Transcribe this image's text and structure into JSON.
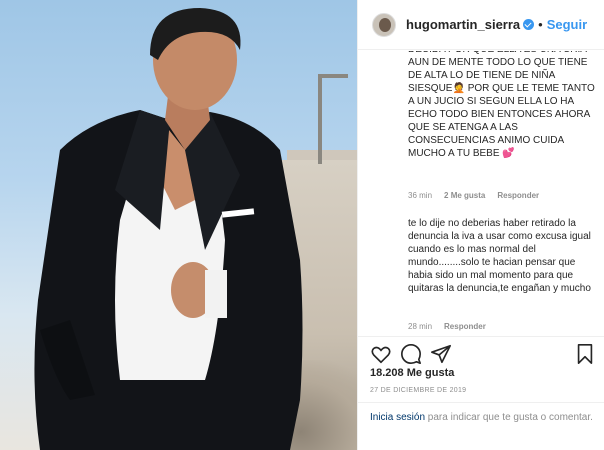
{
  "post": {
    "username": "hugomartin_sierra",
    "follow_label": "Seguir",
    "separator": "•"
  },
  "comments": [
    {
      "text": "DECIDA POR QUE ELLA ES UNA CRIA AUN DE MENTE TODO LO QUE TIENE DE ALTA LO DE TIENE DE NIÑA SIESQUE🤦 POR QUE LE TEME TANTO A UN JUCIO SI SEGUN ELLA LO HA ECHO TODO BIEN ENTONCES AHORA QUE SE ATENGA A LAS CONSECUENCIAS ANIMO CUIDA MUCHO A TU BEBE 💕",
      "time": "36 min",
      "likes": "2 Me gusta",
      "reply": "Responder"
    },
    {
      "text": "te lo dije no deberias haber retirado la denuncia la iva a usar como excusa igual cuando es lo mas normal del mundo........solo te hacian pensar que habia sido un mal momento para que quitaras la denuncia,te engañan y mucho",
      "time": "28 min",
      "reply": "Responder"
    }
  ],
  "footer": {
    "likes_count": "18.208 Me gusta",
    "date": "27 DE DICIEMBRE DE 2019",
    "login_link": "Inicia sesión",
    "login_text": " para indicar que te gusta o comentar."
  },
  "icons": {
    "like": "heart-icon",
    "comment": "comment-icon",
    "share": "share-icon",
    "save": "bookmark-icon",
    "verified": "verified-badge-icon"
  },
  "colors": {
    "accent": "#3897f0",
    "muted": "#8e8e8e",
    "link": "#00376b"
  }
}
